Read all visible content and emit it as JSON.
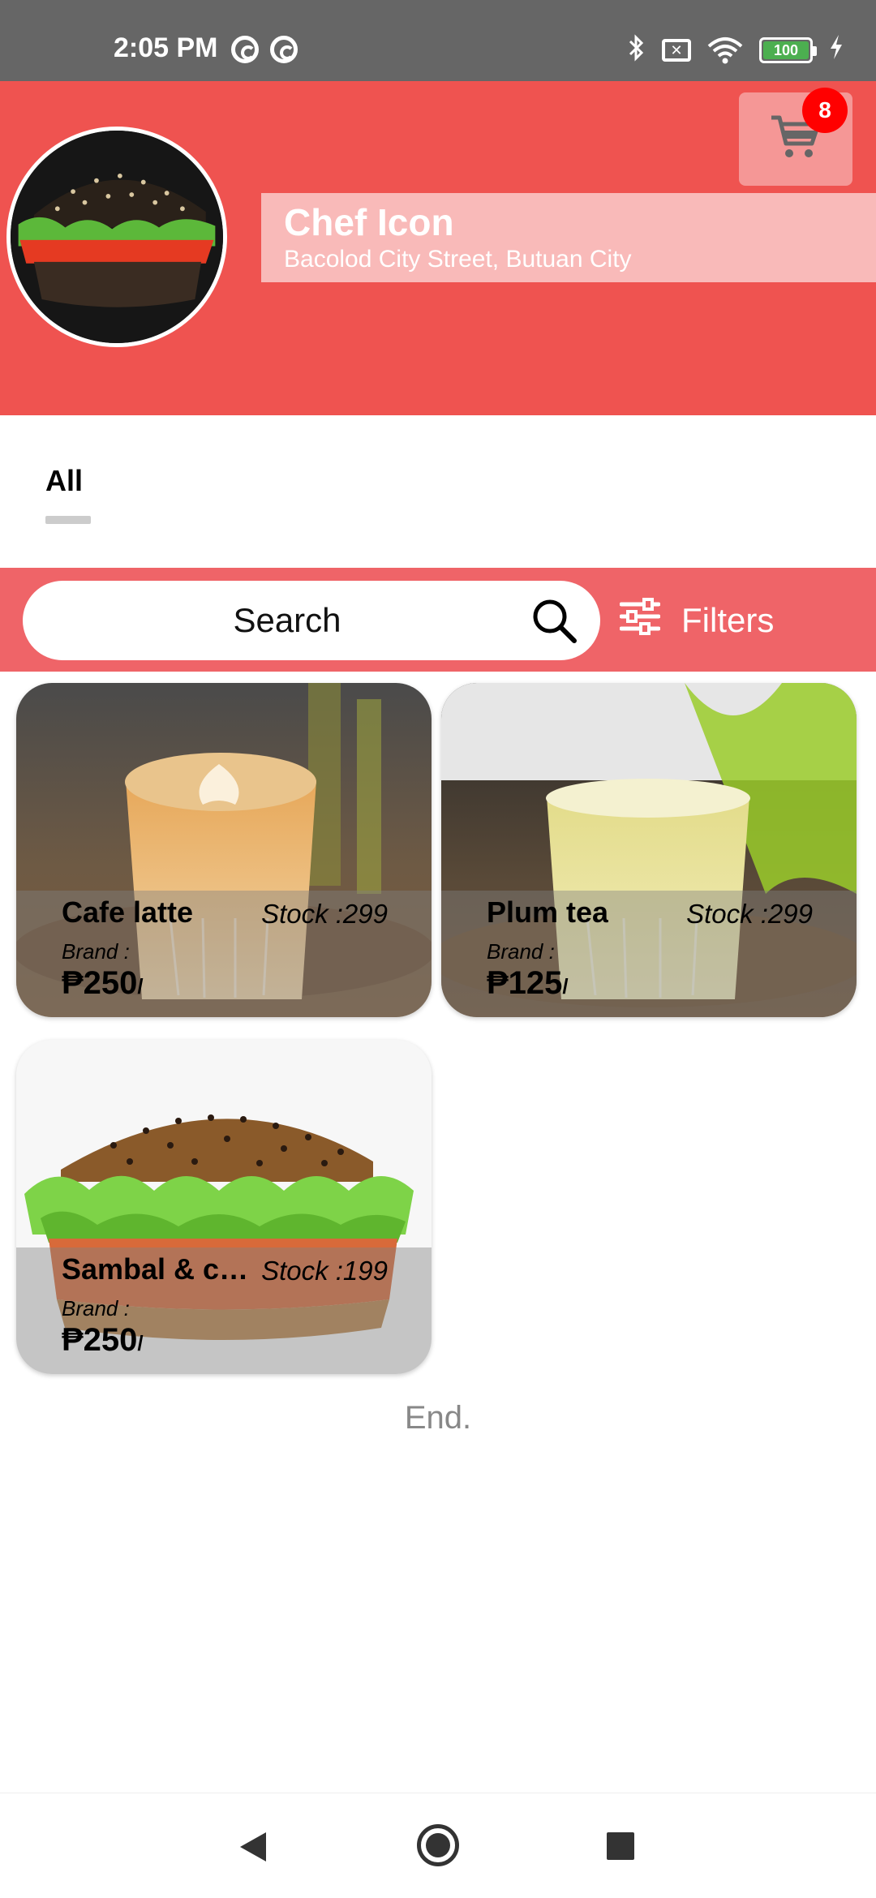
{
  "status_bar": {
    "time": "2:05 PM",
    "battery_level": "100",
    "icons": [
      "cast-ring-icon",
      "cast-ring-icon",
      "bluetooth-icon",
      "no-sim-icon",
      "wifi-icon",
      "battery-icon",
      "charging-bolt-icon"
    ]
  },
  "store": {
    "name": "Chef Icon",
    "address": "Bacolod City Street, Butuan City"
  },
  "cart": {
    "badge_count": "8",
    "icon": "shopping-cart-icon"
  },
  "tabs": [
    {
      "label": "All",
      "selected": true
    }
  ],
  "search": {
    "placeholder": "Search",
    "filters_label": "Filters"
  },
  "products": [
    {
      "name": "Cafe latte",
      "stock": "Stock :299",
      "brand": "Brand :",
      "price": "₱250",
      "price_suffix": "/"
    },
    {
      "name": "Plum tea",
      "stock": "Stock :299",
      "brand": "Brand :",
      "price": "₱125",
      "price_suffix": "/"
    },
    {
      "name": "Sambal & chicken",
      "stock": "Stock :199",
      "brand": "Brand :",
      "price": "₱250",
      "price_suffix": "/"
    }
  ],
  "end_label": "End.",
  "colors": {
    "header_red": "#ef5350",
    "search_bar_red": "#ef6468",
    "badge_red": "#ff0000"
  }
}
